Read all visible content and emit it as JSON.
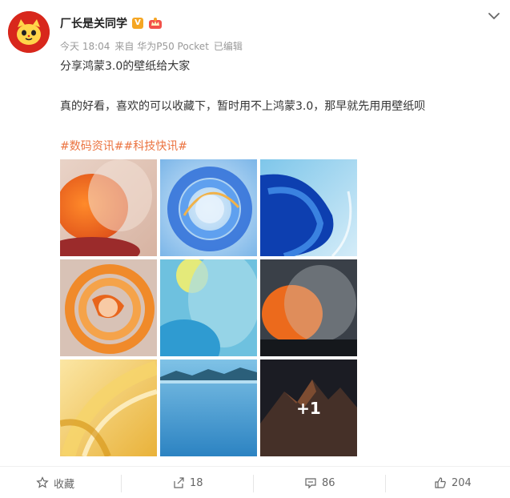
{
  "author": {
    "name": "厂长是关同学",
    "badge_label": "V"
  },
  "meta": {
    "time": "今天 18:04",
    "source": "来自 华为P50 Pocket",
    "edited": "已编辑"
  },
  "post": {
    "line1": "分享鸿蒙3.0的壁纸给大家",
    "line2": "真的好看，喜欢的可以收藏下，暂时用不上鸿蒙3.0，那早就先用用壁纸呗",
    "tags": [
      "#数码资讯#",
      "#科技快讯#"
    ]
  },
  "gallery": {
    "more_label": "+1"
  },
  "actions": {
    "favorite_label": "收藏",
    "repost_count": "18",
    "comment_count": "86",
    "like_count": "204"
  },
  "colors": {
    "tag": "#eb7340",
    "avatar_bg": "#d8271c",
    "badge": "#f5a623"
  }
}
